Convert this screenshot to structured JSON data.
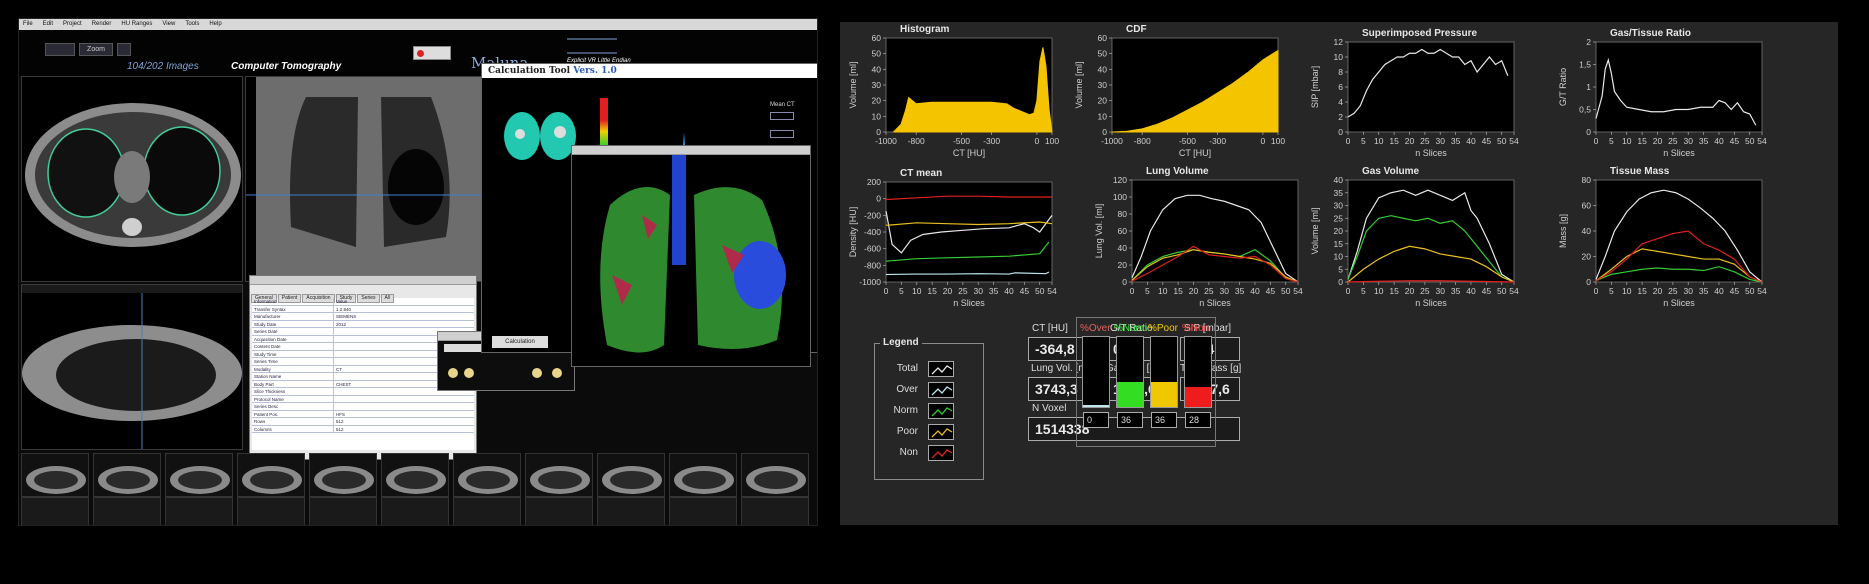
{
  "viewer": {
    "menu": [
      "File",
      "Edit",
      "Project",
      "Render",
      "HU Ranges",
      "View",
      "Tools",
      "Help"
    ],
    "toolbar_buttons": [
      "Zoom"
    ],
    "image_counter": "104/202",
    "image_counter_suffix": "Images",
    "modality": "Computer Tomography",
    "app_name": "Maluna",
    "dicom_info": [
      "Explicit VR Little Endian"
    ],
    "calc_tool": {
      "title": "Calculation Tool",
      "version": "Vers. 1.0",
      "scale_labels": [
        "-1000",
        "-500",
        "-100",
        "0",
        "100",
        "1000"
      ],
      "mean_ct_label": "Mean CT",
      "button_label": "Calculation"
    },
    "props_window": {
      "tabs": [
        "General",
        "Patient",
        "Acquisition",
        "Study",
        "Series",
        "All"
      ],
      "rows": [
        [
          "Information",
          "Value"
        ],
        [
          "Transfer Syntax",
          "1.2.840"
        ],
        [
          "Manufacturer",
          "SIEMENS"
        ],
        [
          "Study Date",
          "2012"
        ],
        [
          "Series Date",
          ""
        ],
        [
          "Acquisition Date",
          ""
        ],
        [
          "Content Date",
          ""
        ],
        [
          "Study Time",
          ""
        ],
        [
          "Series Time",
          ""
        ],
        [
          "Modality",
          "CT"
        ],
        [
          "Station Name",
          ""
        ],
        [
          "Body Part",
          "CHEST"
        ],
        [
          "Slice Thickness",
          ""
        ],
        [
          "Protocol Name",
          ""
        ],
        [
          "Series Desc",
          ""
        ],
        [
          "Patient Pos.",
          "HFS"
        ],
        [
          "Rows",
          "512"
        ],
        [
          "Columns",
          "512"
        ]
      ]
    }
  },
  "colors": {
    "yellow": "#f5c400",
    "norm": "#33cc33",
    "poor": "#e8c020",
    "non": "#e02020",
    "total": "#e8e8e8",
    "over": "#bfe8ee",
    "panel": "#262626",
    "plot": "#000000"
  },
  "charts": {
    "histogram": {
      "type": "area",
      "title": "Histogram",
      "xlabel": "CT [HU]",
      "ylabel": "Volume [ml]",
      "xlim": [
        -1000,
        100
      ],
      "ylim": [
        0,
        60
      ],
      "xticks": [
        -1000,
        -800,
        -500,
        -300,
        0,
        100
      ],
      "yticks": [
        0,
        10,
        20,
        30,
        40,
        50,
        60
      ],
      "x": [
        -950,
        -900,
        -870,
        -850,
        -800,
        -700,
        -600,
        -500,
        -400,
        -300,
        -200,
        -150,
        -100,
        -50,
        -20,
        0,
        20,
        40,
        60,
        80,
        100
      ],
      "y": [
        0,
        5,
        14,
        22,
        18,
        19,
        19,
        19,
        19,
        19,
        18,
        15,
        13,
        11,
        12,
        20,
        45,
        54,
        42,
        15,
        0
      ]
    },
    "cdf": {
      "type": "area",
      "title": "CDF",
      "xlabel": "CT [HU]",
      "ylabel": "Volume [ml]",
      "xlim": [
        -1000,
        100
      ],
      "ylim": [
        0,
        60
      ],
      "xticks": [
        -1000,
        -800,
        -500,
        -300,
        0,
        100
      ],
      "yticks": [
        0,
        10,
        20,
        30,
        40,
        50,
        60
      ],
      "x": [
        -1000,
        -900,
        -800,
        -700,
        -600,
        -500,
        -400,
        -300,
        -200,
        -100,
        0,
        100
      ],
      "y": [
        0,
        0.5,
        2,
        5,
        9,
        14,
        19,
        25,
        31,
        38,
        46,
        52
      ]
    },
    "pressure": {
      "type": "line",
      "title": "Superimposed Pressure",
      "xlabel": "n Slices",
      "ylabel": "SIP [mbar]",
      "xlim": [
        0,
        54
      ],
      "ylim": [
        0,
        12
      ],
      "yticks": [
        0,
        2,
        4,
        6,
        8,
        10,
        12
      ],
      "xticks": [
        0,
        5,
        10,
        15,
        20,
        25,
        30,
        35,
        40,
        45,
        50,
        54
      ],
      "x": [
        0,
        2,
        4,
        6,
        8,
        10,
        12,
        14,
        16,
        18,
        20,
        22,
        24,
        26,
        28,
        30,
        32,
        34,
        36,
        38,
        40,
        42,
        44,
        46,
        48,
        50,
        52
      ],
      "y": [
        2,
        2.5,
        3.5,
        5.5,
        7,
        8,
        9,
        9.5,
        10,
        10,
        10.5,
        10.5,
        11,
        10.5,
        10.5,
        11,
        10.5,
        10,
        10,
        9,
        9.5,
        8,
        9,
        10,
        9,
        9.5,
        7.5
      ]
    },
    "gt_ratio": {
      "type": "line",
      "title": "Gas/Tissue Ratio",
      "xlabel": "n Slices",
      "ylabel": "G/T Ratio",
      "xlim": [
        0,
        54
      ],
      "ylim": [
        0,
        2
      ],
      "yticks": [
        "0",
        "0,5",
        "1",
        "1,5",
        "2"
      ],
      "xticks": [
        0,
        5,
        10,
        15,
        20,
        25,
        30,
        35,
        40,
        45,
        50,
        54
      ],
      "x": [
        0,
        2,
        3,
        4,
        5,
        6,
        8,
        10,
        14,
        18,
        22,
        26,
        30,
        34,
        38,
        40,
        42,
        44,
        46,
        48,
        50,
        52
      ],
      "y": [
        0.3,
        0.8,
        1.4,
        1.6,
        1.3,
        0.9,
        0.7,
        0.55,
        0.5,
        0.45,
        0.45,
        0.5,
        0.5,
        0.55,
        0.55,
        0.7,
        0.65,
        0.5,
        0.65,
        0.45,
        0.4,
        0.15
      ]
    },
    "ct_mean": {
      "type": "line",
      "title": "CT mean",
      "xlabel": "n Slices",
      "ylabel": "Density [HU]",
      "xlim": [
        0,
        54
      ],
      "ylim": [
        -1000,
        200
      ],
      "yticks": [
        -1000,
        -800,
        -600,
        -400,
        -200,
        0,
        200
      ],
      "xticks": [
        0,
        5,
        10,
        15,
        20,
        25,
        30,
        35,
        40,
        45,
        50,
        54
      ],
      "series": [
        {
          "name": "Total",
          "key": "total",
          "x": [
            0,
            2,
            5,
            8,
            12,
            18,
            25,
            32,
            40,
            45,
            48,
            50,
            52,
            54
          ],
          "y": [
            -150,
            -550,
            -650,
            -500,
            -430,
            -400,
            -380,
            -360,
            -350,
            -300,
            -350,
            -400,
            -300,
            -200
          ]
        },
        {
          "name": "Over",
          "key": "over",
          "x": [
            0,
            10,
            20,
            30,
            40,
            42,
            52,
            53
          ],
          "y": [
            -910,
            -905,
            -905,
            -900,
            -905,
            -890,
            -900,
            -880
          ]
        },
        {
          "name": "Norm",
          "key": "norm",
          "x": [
            0,
            10,
            20,
            30,
            40,
            50,
            53
          ],
          "y": [
            -750,
            -720,
            -710,
            -700,
            -690,
            -660,
            -520
          ]
        },
        {
          "name": "Poor",
          "key": "poor",
          "x": [
            0,
            10,
            20,
            30,
            40,
            50,
            54
          ],
          "y": [
            -320,
            -290,
            -300,
            -310,
            -300,
            -280,
            -300
          ]
        },
        {
          "name": "Non",
          "key": "non",
          "x": [
            0,
            10,
            20,
            30,
            40,
            50,
            54
          ],
          "y": [
            -10,
            10,
            30,
            30,
            20,
            20,
            20
          ]
        }
      ]
    },
    "lung_volume": {
      "type": "line",
      "title": "Lung Volume",
      "xlabel": "n Slices",
      "ylabel": "Lung Vol. [ml]",
      "xlim": [
        0,
        54
      ],
      "ylim": [
        0,
        120
      ],
      "yticks": [
        0,
        20,
        40,
        60,
        80,
        100,
        120
      ],
      "xticks": [
        0,
        5,
        10,
        15,
        20,
        25,
        30,
        35,
        40,
        45,
        50,
        54
      ],
      "series": [
        {
          "name": "Total",
          "key": "total",
          "x": [
            0,
            3,
            6,
            10,
            14,
            18,
            22,
            26,
            30,
            34,
            38,
            42,
            46,
            50,
            54
          ],
          "y": [
            5,
            30,
            60,
            85,
            98,
            102,
            102,
            98,
            95,
            90,
            85,
            70,
            40,
            10,
            0
          ]
        },
        {
          "name": "Norm",
          "key": "norm",
          "x": [
            0,
            5,
            10,
            15,
            20,
            25,
            30,
            35,
            40,
            45,
            50,
            54
          ],
          "y": [
            2,
            20,
            30,
            35,
            38,
            35,
            33,
            30,
            38,
            25,
            5,
            0
          ]
        },
        {
          "name": "Poor",
          "key": "poor",
          "x": [
            0,
            5,
            10,
            15,
            20,
            25,
            30,
            35,
            40,
            45,
            50,
            54
          ],
          "y": [
            2,
            18,
            28,
            32,
            38,
            35,
            33,
            30,
            27,
            22,
            6,
            0
          ]
        },
        {
          "name": "Non",
          "key": "non",
          "x": [
            0,
            5,
            10,
            15,
            20,
            25,
            30,
            35,
            40,
            45,
            50,
            54
          ],
          "y": [
            1,
            10,
            20,
            30,
            42,
            32,
            30,
            28,
            30,
            20,
            4,
            0
          ]
        }
      ]
    },
    "gas_volume": {
      "type": "line",
      "title": "Gas Volume",
      "xlabel": "n Slices",
      "ylabel": "Volume [ml]",
      "xlim": [
        0,
        54
      ],
      "ylim": [
        0,
        40
      ],
      "yticks": [
        0,
        5,
        10,
        15,
        20,
        25,
        30,
        35,
        40
      ],
      "xticks": [
        0,
        5,
        10,
        15,
        20,
        25,
        30,
        35,
        40,
        45,
        50,
        54
      ],
      "series": [
        {
          "name": "Total",
          "key": "total",
          "x": [
            0,
            3,
            6,
            10,
            14,
            18,
            22,
            26,
            30,
            34,
            38,
            40,
            42,
            46,
            50,
            54
          ],
          "y": [
            1,
            12,
            25,
            33,
            35,
            36,
            34,
            36,
            34,
            32,
            35,
            28,
            25,
            15,
            3,
            0
          ]
        },
        {
          "name": "Norm",
          "key": "norm",
          "x": [
            0,
            3,
            6,
            10,
            14,
            18,
            22,
            26,
            30,
            34,
            38,
            42,
            46,
            50,
            54
          ],
          "y": [
            1,
            10,
            20,
            25,
            26,
            25,
            24,
            25,
            23,
            24,
            20,
            14,
            8,
            2,
            0
          ]
        },
        {
          "name": "Poor",
          "key": "poor",
          "x": [
            0,
            5,
            10,
            15,
            20,
            25,
            30,
            35,
            40,
            45,
            50,
            54
          ],
          "y": [
            0,
            5,
            9,
            12,
            14,
            13,
            11,
            10,
            9,
            6,
            2,
            0
          ]
        },
        {
          "name": "Non",
          "key": "non",
          "x": [
            0,
            10,
            20,
            30,
            40,
            50,
            54
          ],
          "y": [
            0,
            0.3,
            0.5,
            0.5,
            0.3,
            0.1,
            0
          ]
        }
      ]
    },
    "tissue_mass": {
      "type": "line",
      "title": "Tissue Mass",
      "xlabel": "n Slices",
      "ylabel": "Mass [g]",
      "xlim": [
        0,
        54
      ],
      "ylim": [
        0,
        80
      ],
      "yticks": [
        0,
        20,
        40,
        60,
        80
      ],
      "xticks": [
        0,
        5,
        10,
        15,
        20,
        25,
        30,
        35,
        40,
        45,
        50,
        54
      ],
      "series": [
        {
          "name": "Total",
          "key": "total",
          "x": [
            0,
            3,
            6,
            10,
            14,
            18,
            22,
            26,
            30,
            34,
            38,
            42,
            46,
            50,
            54
          ],
          "y": [
            2,
            20,
            40,
            55,
            65,
            70,
            72,
            70,
            65,
            58,
            50,
            40,
            25,
            8,
            0
          ]
        },
        {
          "name": "Norm",
          "key": "norm",
          "x": [
            0,
            5,
            10,
            15,
            20,
            25,
            30,
            35,
            40,
            45,
            50,
            54
          ],
          "y": [
            1,
            6,
            8,
            10,
            11,
            10,
            10,
            9,
            12,
            8,
            2,
            0
          ]
        },
        {
          "name": "Poor",
          "key": "poor",
          "x": [
            0,
            5,
            10,
            15,
            20,
            25,
            30,
            35,
            40,
            45,
            50,
            54
          ],
          "y": [
            1,
            10,
            20,
            26,
            24,
            22,
            20,
            18,
            18,
            14,
            4,
            0
          ]
        },
        {
          "name": "Non",
          "key": "non",
          "x": [
            0,
            5,
            10,
            15,
            20,
            25,
            30,
            35,
            40,
            45,
            50,
            54
          ],
          "y": [
            1,
            8,
            18,
            30,
            34,
            38,
            40,
            30,
            25,
            18,
            4,
            0
          ]
        }
      ]
    }
  },
  "legend": {
    "title": "Legend",
    "items": [
      {
        "label": "Total",
        "key": "total"
      },
      {
        "label": "Over",
        "key": "over"
      },
      {
        "label": "Norm",
        "key": "norm"
      },
      {
        "label": "Poor",
        "key": "poor"
      },
      {
        "label": "Non",
        "key": "non"
      }
    ]
  },
  "stats": {
    "ct_label": "CT [HU]",
    "ct_value": "-364,8",
    "gt_label": "G/T Ratio",
    "gt_value": "0,62",
    "sip_label": "SIP [mbar]",
    "sip_value": "8,44",
    "lung_label": "Lung Vol. [ml]",
    "lung_value": "3743,3",
    "gas_label": "Gas Vol. [ml]",
    "gas_value": "1378,6",
    "tiss_label": "Tiss. Mass [g]",
    "tiss_value": "2387,6",
    "voxel_label": "N Voxel",
    "voxel_value": "1514338"
  },
  "percentages": [
    {
      "label": "%Over",
      "value": "0",
      "fraction": 0.03,
      "color": "#bfe8ee",
      "label_color": "#e06060"
    },
    {
      "label": "%Norm",
      "value": "36",
      "fraction": 0.36,
      "color": "#33dd22",
      "label_color": "#44ee44"
    },
    {
      "label": "%Poor",
      "value": "36",
      "fraction": 0.36,
      "color": "#f0c800",
      "label_color": "#f0c800"
    },
    {
      "label": "%Non",
      "value": "28",
      "fraction": 0.28,
      "color": "#ee1c1c",
      "label_color": "#ff4444"
    }
  ]
}
